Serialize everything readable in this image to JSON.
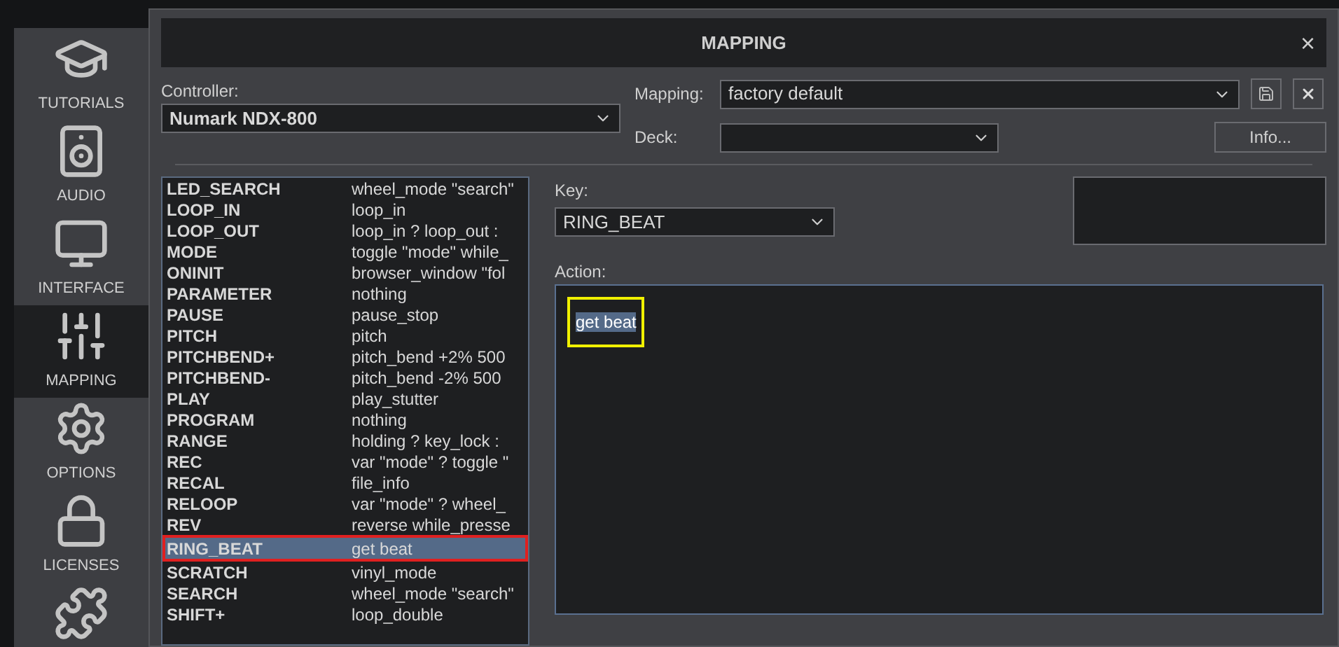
{
  "sidebar": {
    "items": [
      {
        "label": "TUTORIALS",
        "selected": false
      },
      {
        "label": "AUDIO",
        "selected": false
      },
      {
        "label": "INTERFACE",
        "selected": false
      },
      {
        "label": "MAPPING",
        "selected": true
      },
      {
        "label": "OPTIONS",
        "selected": false
      },
      {
        "label": "LICENSES",
        "selected": false
      },
      {
        "selected": false
      }
    ]
  },
  "dialog": {
    "title": "MAPPING",
    "close": "×"
  },
  "controller": {
    "label": "Controller:",
    "value": "Numark NDX-800"
  },
  "mapping": {
    "label": "Mapping:",
    "value": "factory default"
  },
  "deck": {
    "label": "Deck:"
  },
  "info_button": "Info...",
  "key_list": [
    {
      "key": "LED_SEARCH",
      "action": "wheel_mode \"search\"",
      "selected": false
    },
    {
      "key": "LOOP_IN",
      "action": "loop_in",
      "selected": false
    },
    {
      "key": "LOOP_OUT",
      "action": "loop_in ? loop_out :",
      "selected": false
    },
    {
      "key": "MODE",
      "action": "toggle \"mode\" while_",
      "selected": false
    },
    {
      "key": "ONINIT",
      "action": "browser_window \"fol",
      "selected": false
    },
    {
      "key": "PARAMETER",
      "action": "nothing",
      "selected": false
    },
    {
      "key": "PAUSE",
      "action": "pause_stop",
      "selected": false
    },
    {
      "key": "PITCH",
      "action": "pitch",
      "selected": false
    },
    {
      "key": "PITCHBEND+",
      "action": "pitch_bend +2% 500",
      "selected": false
    },
    {
      "key": "PITCHBEND-",
      "action": "pitch_bend -2% 500",
      "selected": false
    },
    {
      "key": "PLAY",
      "action": "play_stutter",
      "selected": false
    },
    {
      "key": "PROGRAM",
      "action": "nothing",
      "selected": false
    },
    {
      "key": "RANGE",
      "action": "holding ? key_lock :",
      "selected": false
    },
    {
      "key": "REC",
      "action": "var \"mode\" ? toggle \"",
      "selected": false
    },
    {
      "key": "RECAL",
      "action": "file_info",
      "selected": false
    },
    {
      "key": "RELOOP",
      "action": "var \"mode\" ? wheel_",
      "selected": false
    },
    {
      "key": "REV",
      "action": "reverse while_presse",
      "selected": false
    },
    {
      "key": "RING_BEAT",
      "action": "get beat",
      "selected": true
    },
    {
      "key": "SCRATCH",
      "action": "vinyl_mode",
      "selected": false
    },
    {
      "key": "SEARCH",
      "action": "wheel_mode \"search\"",
      "selected": false
    },
    {
      "key": "SHIFT+",
      "action": "loop_double",
      "selected": false
    }
  ],
  "key": {
    "label": "Key:",
    "value": "RING_BEAT"
  },
  "action": {
    "label": "Action:",
    "value": "get beat"
  }
}
